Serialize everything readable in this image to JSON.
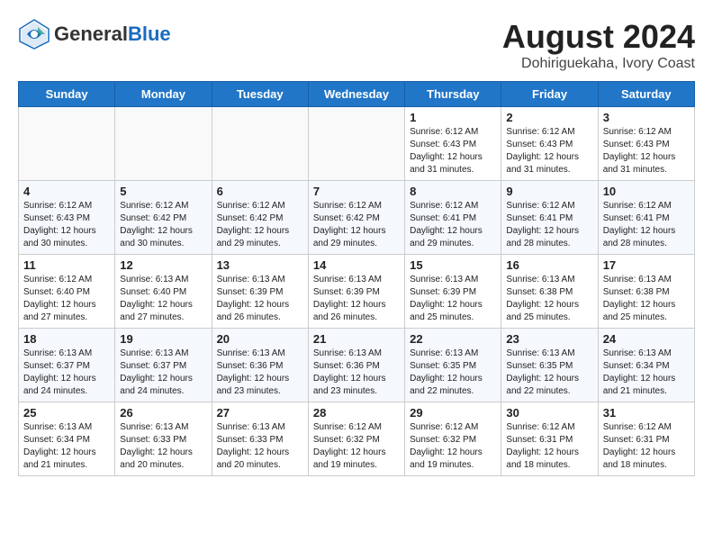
{
  "header": {
    "logo_general": "General",
    "logo_blue": "Blue",
    "title": "August 2024",
    "subtitle": "Dohiriguekaha, Ivory Coast"
  },
  "weekdays": [
    "Sunday",
    "Monday",
    "Tuesday",
    "Wednesday",
    "Thursday",
    "Friday",
    "Saturday"
  ],
  "weeks": [
    [
      {
        "day": "",
        "info": ""
      },
      {
        "day": "",
        "info": ""
      },
      {
        "day": "",
        "info": ""
      },
      {
        "day": "",
        "info": ""
      },
      {
        "day": "1",
        "info": "Sunrise: 6:12 AM\nSunset: 6:43 PM\nDaylight: 12 hours\nand 31 minutes."
      },
      {
        "day": "2",
        "info": "Sunrise: 6:12 AM\nSunset: 6:43 PM\nDaylight: 12 hours\nand 31 minutes."
      },
      {
        "day": "3",
        "info": "Sunrise: 6:12 AM\nSunset: 6:43 PM\nDaylight: 12 hours\nand 31 minutes."
      }
    ],
    [
      {
        "day": "4",
        "info": "Sunrise: 6:12 AM\nSunset: 6:43 PM\nDaylight: 12 hours\nand 30 minutes."
      },
      {
        "day": "5",
        "info": "Sunrise: 6:12 AM\nSunset: 6:42 PM\nDaylight: 12 hours\nand 30 minutes."
      },
      {
        "day": "6",
        "info": "Sunrise: 6:12 AM\nSunset: 6:42 PM\nDaylight: 12 hours\nand 29 minutes."
      },
      {
        "day": "7",
        "info": "Sunrise: 6:12 AM\nSunset: 6:42 PM\nDaylight: 12 hours\nand 29 minutes."
      },
      {
        "day": "8",
        "info": "Sunrise: 6:12 AM\nSunset: 6:41 PM\nDaylight: 12 hours\nand 29 minutes."
      },
      {
        "day": "9",
        "info": "Sunrise: 6:12 AM\nSunset: 6:41 PM\nDaylight: 12 hours\nand 28 minutes."
      },
      {
        "day": "10",
        "info": "Sunrise: 6:12 AM\nSunset: 6:41 PM\nDaylight: 12 hours\nand 28 minutes."
      }
    ],
    [
      {
        "day": "11",
        "info": "Sunrise: 6:12 AM\nSunset: 6:40 PM\nDaylight: 12 hours\nand 27 minutes."
      },
      {
        "day": "12",
        "info": "Sunrise: 6:13 AM\nSunset: 6:40 PM\nDaylight: 12 hours\nand 27 minutes."
      },
      {
        "day": "13",
        "info": "Sunrise: 6:13 AM\nSunset: 6:39 PM\nDaylight: 12 hours\nand 26 minutes."
      },
      {
        "day": "14",
        "info": "Sunrise: 6:13 AM\nSunset: 6:39 PM\nDaylight: 12 hours\nand 26 minutes."
      },
      {
        "day": "15",
        "info": "Sunrise: 6:13 AM\nSunset: 6:39 PM\nDaylight: 12 hours\nand 25 minutes."
      },
      {
        "day": "16",
        "info": "Sunrise: 6:13 AM\nSunset: 6:38 PM\nDaylight: 12 hours\nand 25 minutes."
      },
      {
        "day": "17",
        "info": "Sunrise: 6:13 AM\nSunset: 6:38 PM\nDaylight: 12 hours\nand 25 minutes."
      }
    ],
    [
      {
        "day": "18",
        "info": "Sunrise: 6:13 AM\nSunset: 6:37 PM\nDaylight: 12 hours\nand 24 minutes."
      },
      {
        "day": "19",
        "info": "Sunrise: 6:13 AM\nSunset: 6:37 PM\nDaylight: 12 hours\nand 24 minutes."
      },
      {
        "day": "20",
        "info": "Sunrise: 6:13 AM\nSunset: 6:36 PM\nDaylight: 12 hours\nand 23 minutes."
      },
      {
        "day": "21",
        "info": "Sunrise: 6:13 AM\nSunset: 6:36 PM\nDaylight: 12 hours\nand 23 minutes."
      },
      {
        "day": "22",
        "info": "Sunrise: 6:13 AM\nSunset: 6:35 PM\nDaylight: 12 hours\nand 22 minutes."
      },
      {
        "day": "23",
        "info": "Sunrise: 6:13 AM\nSunset: 6:35 PM\nDaylight: 12 hours\nand 22 minutes."
      },
      {
        "day": "24",
        "info": "Sunrise: 6:13 AM\nSunset: 6:34 PM\nDaylight: 12 hours\nand 21 minutes."
      }
    ],
    [
      {
        "day": "25",
        "info": "Sunrise: 6:13 AM\nSunset: 6:34 PM\nDaylight: 12 hours\nand 21 minutes."
      },
      {
        "day": "26",
        "info": "Sunrise: 6:13 AM\nSunset: 6:33 PM\nDaylight: 12 hours\nand 20 minutes."
      },
      {
        "day": "27",
        "info": "Sunrise: 6:13 AM\nSunset: 6:33 PM\nDaylight: 12 hours\nand 20 minutes."
      },
      {
        "day": "28",
        "info": "Sunrise: 6:12 AM\nSunset: 6:32 PM\nDaylight: 12 hours\nand 19 minutes."
      },
      {
        "day": "29",
        "info": "Sunrise: 6:12 AM\nSunset: 6:32 PM\nDaylight: 12 hours\nand 19 minutes."
      },
      {
        "day": "30",
        "info": "Sunrise: 6:12 AM\nSunset: 6:31 PM\nDaylight: 12 hours\nand 18 minutes."
      },
      {
        "day": "31",
        "info": "Sunrise: 6:12 AM\nSunset: 6:31 PM\nDaylight: 12 hours\nand 18 minutes."
      }
    ]
  ]
}
